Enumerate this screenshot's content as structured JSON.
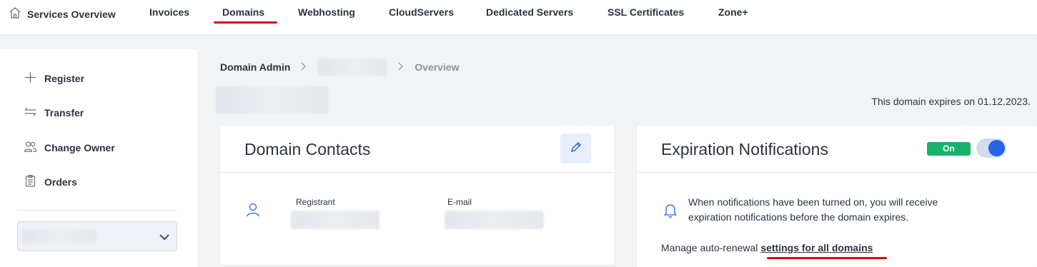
{
  "nav": {
    "items": [
      {
        "label": "Services Overview",
        "icon": "home-icon"
      },
      {
        "label": "Invoices"
      },
      {
        "label": "Domains",
        "active": true
      },
      {
        "label": "Webhosting"
      },
      {
        "label": "CloudServers"
      },
      {
        "label": "Dedicated Servers"
      },
      {
        "label": "SSL Certificates"
      },
      {
        "label": "Zone+"
      }
    ],
    "active_underline_color": "#e3001b"
  },
  "sidebar": {
    "items": [
      {
        "label": "Register",
        "icon": "plus-icon"
      },
      {
        "label": "Transfer",
        "icon": "transfer-arrows-icon"
      },
      {
        "label": "Change Owner",
        "icon": "users-icon"
      },
      {
        "label": "Orders",
        "icon": "clipboard-icon"
      }
    ]
  },
  "breadcrumb": {
    "root": "Domain Admin",
    "current": "Overview"
  },
  "expiry_text": "This domain expires on 01.12.2023.",
  "contacts_card": {
    "title": "Domain Contacts",
    "registrant_label": "Registrant",
    "email_label": "E-mail"
  },
  "notifications_card": {
    "title": "Expiration Notifications",
    "status_label": "On",
    "toggle_on": true,
    "description": "When notifications have been turned on, you will receive expiration notifications before the domain expires.",
    "manage_prefix": "Manage auto-renewal ",
    "manage_link": "settings for all domains"
  },
  "colors": {
    "accent_red": "#e3001b",
    "accent_blue": "#2563eb",
    "status_green": "#17b26a"
  }
}
